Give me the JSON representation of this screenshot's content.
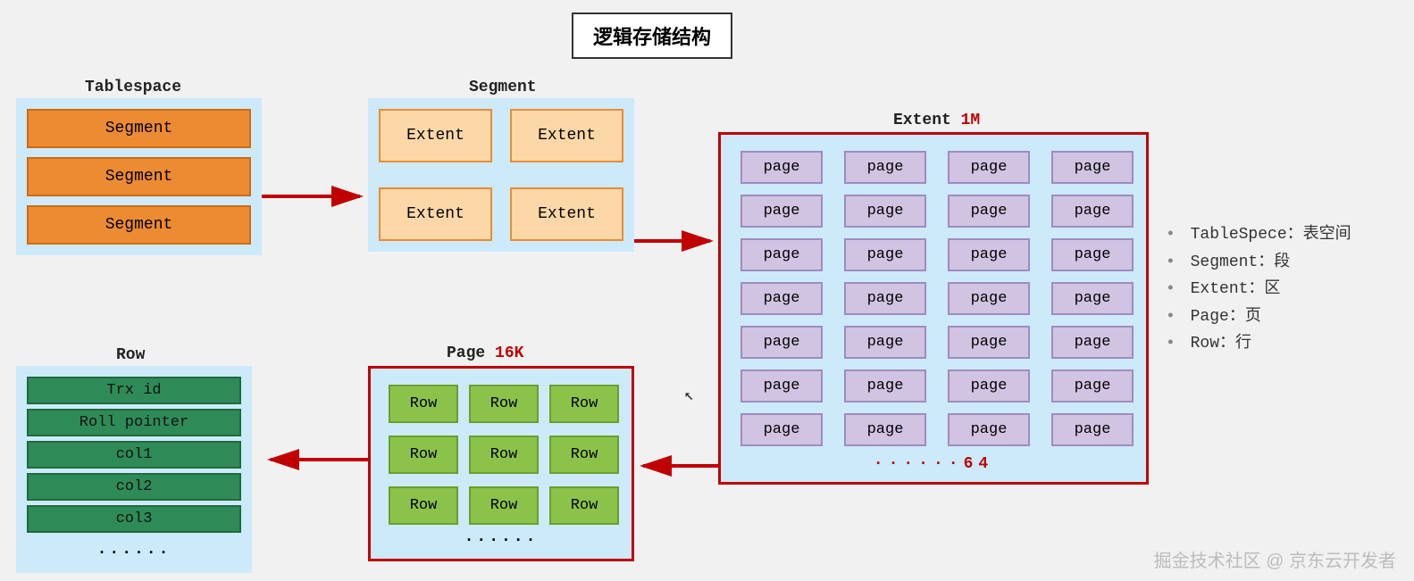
{
  "title": "逻辑存储结构",
  "tablespace": {
    "label": "Tablespace",
    "items": [
      "Segment",
      "Segment",
      "Segment"
    ]
  },
  "segment": {
    "label": "Segment",
    "items": [
      "Extent",
      "Extent",
      "Extent",
      "Extent"
    ]
  },
  "extent": {
    "label_prefix": "Extent ",
    "label_size": "1M",
    "page_label": "page",
    "page_count_shown": 28,
    "ellipsis": "······",
    "total": "64"
  },
  "page": {
    "label_prefix": "Page ",
    "label_size": "16K",
    "row_label": "Row",
    "row_count_shown": 9,
    "ellipsis": "······"
  },
  "row": {
    "label": "Row",
    "items": [
      "Trx id",
      "Roll pointer",
      "col1",
      "col2",
      "col3"
    ],
    "ellipsis": "······"
  },
  "legend": [
    "TableSpece：表空间",
    "Segment：段",
    "Extent：区",
    "Page：页",
    "Row：行"
  ],
  "watermark": "掘金技术社区 @ 京东云开发者"
}
